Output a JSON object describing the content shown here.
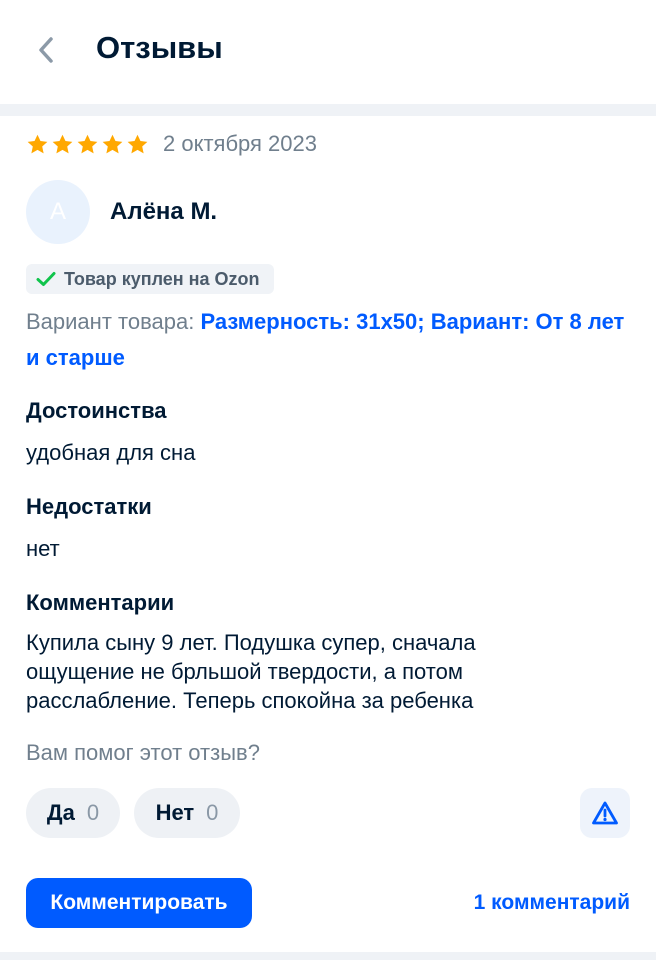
{
  "header": {
    "title": "Отзывы",
    "back_icon": "chevron-left-icon"
  },
  "review": {
    "rating": 5,
    "rating_max": 5,
    "star_color": "#ffa800",
    "date": "2 октября 2023",
    "author": {
      "initial": "А",
      "name": "Алёна М."
    },
    "purchase_badge": {
      "icon": "check-icon",
      "icon_color": "#10c44c",
      "label": "Товар куплен на Ozon"
    },
    "variant": {
      "label": "Вариант товара:",
      "value": "Размерность: 31x50; Вариант: От 8 лет и старше"
    },
    "sections": [
      {
        "title": "Достоинства",
        "text": "удобная для сна"
      },
      {
        "title": "Недостатки",
        "text": "нет"
      },
      {
        "title": "Комментарии",
        "text": "Купила сыну 9 лет. Подушка супер, сначала ощущение не брльшой твердости, а потом расслабление. Теперь спокойна за ребенка"
      }
    ],
    "helpful": {
      "question": "Вам помог этот отзыв?",
      "yes_label": "Да",
      "yes_count": "0",
      "no_label": "Нет",
      "no_count": "0",
      "report_icon": "warning-triangle-icon"
    },
    "actions": {
      "comment_button": "Комментировать",
      "comments_link": "1 комментарий"
    }
  },
  "colors": {
    "accent": "#005bff",
    "text_primary": "#001a34",
    "text_secondary": "#707f8d"
  }
}
